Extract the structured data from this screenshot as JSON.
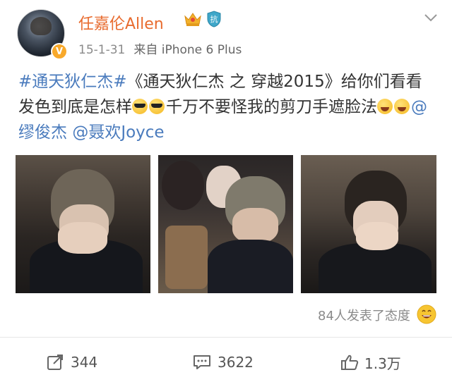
{
  "user": {
    "name": "任嘉伦Allen",
    "verified_badge": "V",
    "badges": [
      "crown-icon",
      "shield-badge-icon"
    ],
    "shield_badge_text": "抗"
  },
  "post": {
    "date": "15-1-31",
    "source": "来自 iPhone 6 Plus",
    "content": {
      "hashtag": "#通天狄仁杰#",
      "text1": "《通天狄仁杰 之 穿越2015》给你们看看发色到底是怎样",
      "text2": "千万不要怪我的剪刀手遮脸法",
      "mention1": "@缪俊杰",
      "mention2": "@聂欢Joyce"
    },
    "photos": [
      {
        "name": "selfie-photo-1"
      },
      {
        "name": "selfie-photo-2"
      },
      {
        "name": "selfie-photo-3"
      }
    ],
    "attitude_text": "84人发表了态度"
  },
  "actions": {
    "repost_count": "344",
    "comment_count": "3622",
    "like_count": "1.3万"
  },
  "colors": {
    "name": "#e86b2e",
    "link": "#4a7bbd",
    "meta": "#8a8a8a",
    "verified": "#f8a92b"
  }
}
